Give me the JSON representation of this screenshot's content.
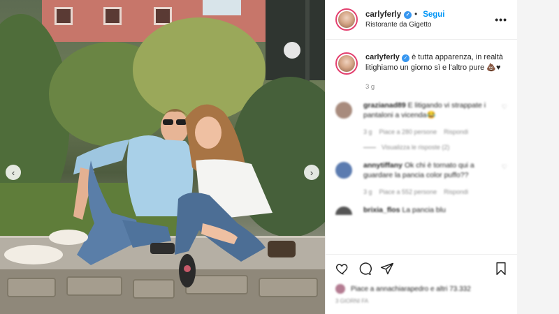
{
  "post": {
    "username": "carlyferly",
    "follow_label": "Segui",
    "location": "Ristorante da Gigetto",
    "more_label": "•••",
    "caption_text": "è tutta apparenza, in realtà litighiamo un giorno sì e l'altro pure",
    "caption_emoji": "💩♥",
    "time": "3 g"
  },
  "comments": [
    {
      "username": "grazianad89",
      "text": "E litigando vi strappate i pantaloni a vicenda😂",
      "meta_time": "3 g",
      "meta_likes": "Piace a 280 persone",
      "meta_reply": "Rispondi",
      "avatar_color": "#a88b7d"
    },
    {
      "username": "annytiffany",
      "text": "Ok chi è tornato qui a guardare la pancia color puffo??",
      "meta_time": "3 g",
      "meta_likes": "Piace a 552 persone",
      "meta_reply": "Rispondi",
      "avatar_color": "#5b7bb0"
    },
    {
      "username": "brixia_flos",
      "text": "La pancia blu",
      "avatar_color": "#555555"
    }
  ],
  "replies_label": "Visualizza le risposte (2)",
  "likes": {
    "text": "Piace a annachiarapedro e altri 73.332"
  },
  "post_date": "3 GIORNI FA",
  "icons": {
    "verified": "verified-badge-icon",
    "more": "more-options-icon",
    "heart": "heart-icon",
    "comment": "comment-icon",
    "share": "share-icon",
    "bookmark": "bookmark-icon",
    "prev": "chevron-left-icon",
    "next": "chevron-right-icon"
  },
  "colors": {
    "link_blue": "#0095f6",
    "verified_blue": "#3897f0",
    "story_ring": "#e3406f"
  }
}
